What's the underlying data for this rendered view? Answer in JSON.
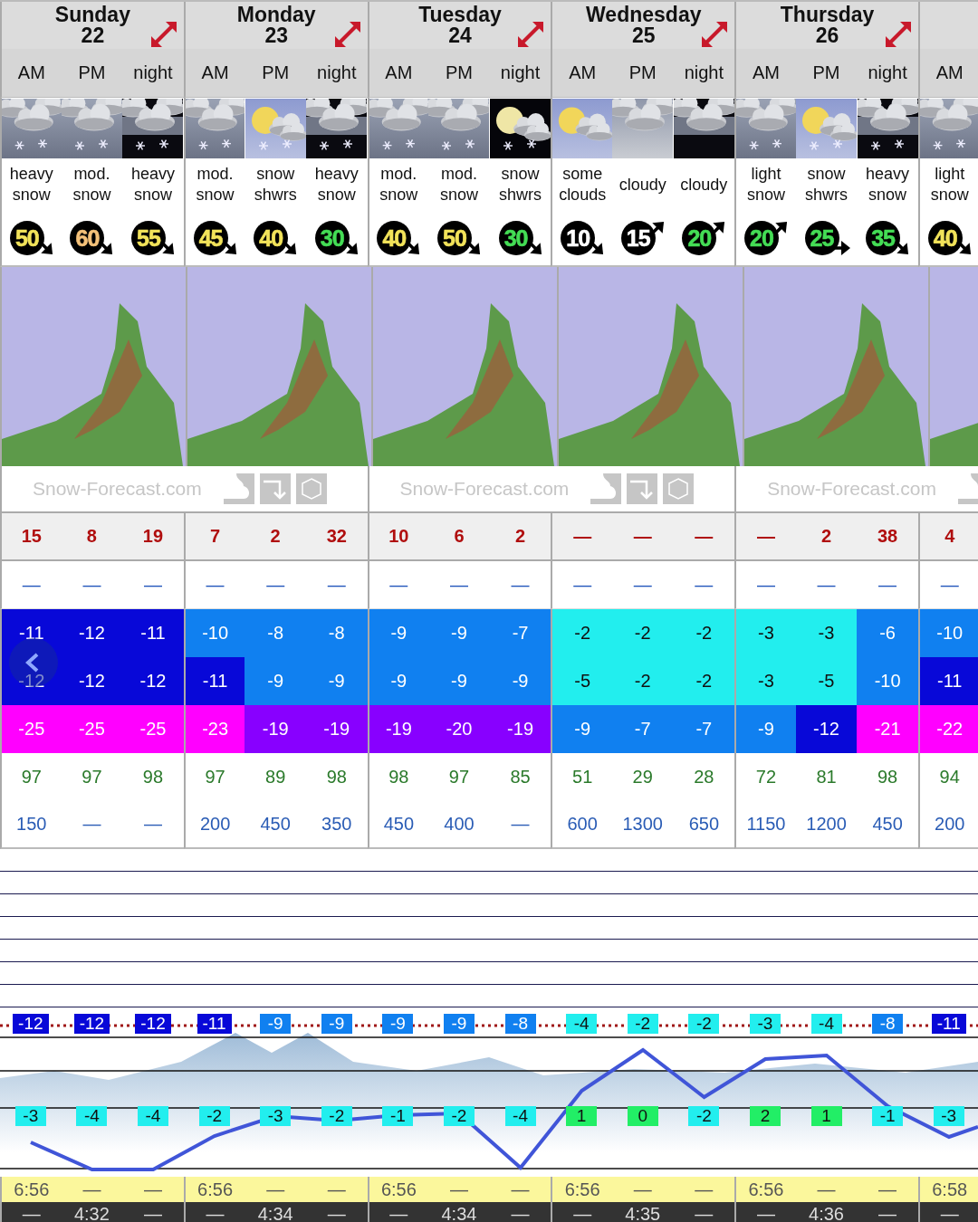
{
  "days": [
    {
      "name": "Sunday",
      "date": "22",
      "periods": [
        {
          "label": "AM",
          "kind": "overcast",
          "snowing": true,
          "summary": "heavy snow",
          "wind": {
            "speed": "50",
            "kind": "down",
            "color": "#f2e35a"
          },
          "snow": "15",
          "rain": "—",
          "max": {
            "value": "-11",
            "color": "#0808d8"
          },
          "min": {
            "value": "-12",
            "color": "#0808d8"
          },
          "chill": {
            "value": "-25",
            "color": "#ff00ff"
          },
          "humidity": "97",
          "freezing": "150",
          "upper": {
            "value": "-12",
            "color": "#0808d8"
          },
          "lower": {
            "value": "-3",
            "color": "#22eeee"
          },
          "sunrise": "6:56",
          "sunset": "—"
        },
        {
          "label": "PM",
          "kind": "overcast",
          "snowing": true,
          "summary": "mod. snow",
          "wind": {
            "speed": "60",
            "kind": "down",
            "color": "#f5c27a"
          },
          "snow": "8",
          "rain": "—",
          "max": {
            "value": "-12",
            "color": "#0808d8"
          },
          "min": {
            "value": "-12",
            "color": "#0808d8"
          },
          "chill": {
            "value": "-25",
            "color": "#ff00ff"
          },
          "humidity": "97",
          "freezing": "—",
          "upper": {
            "value": "-12",
            "color": "#0808d8"
          },
          "lower": {
            "value": "-4",
            "color": "#22eeee"
          },
          "sunrise": "—",
          "sunset": "4:32"
        },
        {
          "label": "night",
          "kind": "dark",
          "snowing": true,
          "summary": "heavy snow",
          "wind": {
            "speed": "55",
            "kind": "down",
            "color": "#f2e35a"
          },
          "snow": "19",
          "rain": "—",
          "max": {
            "value": "-11",
            "color": "#0808d8"
          },
          "min": {
            "value": "-12",
            "color": "#0808d8"
          },
          "chill": {
            "value": "-25",
            "color": "#ff00ff"
          },
          "humidity": "98",
          "freezing": "—",
          "upper": {
            "value": "-12",
            "color": "#0808d8"
          },
          "lower": {
            "value": "-4",
            "color": "#22eeee"
          },
          "sunrise": "—",
          "sunset": "—"
        }
      ]
    },
    {
      "name": "Monday",
      "date": "23",
      "periods": [
        {
          "label": "AM",
          "kind": "overcast",
          "snowing": true,
          "summary": "mod. snow",
          "wind": {
            "speed": "45",
            "kind": "down",
            "color": "#f2e35a"
          },
          "snow": "7",
          "rain": "—",
          "max": {
            "value": "-10",
            "color": "#1080f0"
          },
          "min": {
            "value": "-11",
            "color": "#0808d8"
          },
          "chill": {
            "value": "-23",
            "color": "#ff00ff"
          },
          "humidity": "97",
          "freezing": "200",
          "upper": {
            "value": "-11",
            "color": "#0808d8"
          },
          "lower": {
            "value": "-2",
            "color": "#22eeee"
          },
          "sunrise": "6:56",
          "sunset": "—"
        },
        {
          "label": "PM",
          "kind": "sunny",
          "snowing": true,
          "summary": "snow shwrs",
          "wind": {
            "speed": "40",
            "kind": "down",
            "color": "#f2e35a"
          },
          "snow": "2",
          "rain": "—",
          "max": {
            "value": "-8",
            "color": "#1080f0"
          },
          "min": {
            "value": "-9",
            "color": "#1080f0"
          },
          "chill": {
            "value": "-19",
            "color": "#8800ff"
          },
          "humidity": "89",
          "freezing": "450",
          "upper": {
            "value": "-9",
            "color": "#1080f0"
          },
          "lower": {
            "value": "-3",
            "color": "#22eeee"
          },
          "sunrise": "—",
          "sunset": "4:34"
        },
        {
          "label": "night",
          "kind": "dark",
          "snowing": true,
          "summary": "heavy snow",
          "wind": {
            "speed": "30",
            "kind": "down",
            "color": "#44dd55"
          },
          "snow": "32",
          "rain": "—",
          "max": {
            "value": "-8",
            "color": "#1080f0"
          },
          "min": {
            "value": "-9",
            "color": "#1080f0"
          },
          "chill": {
            "value": "-19",
            "color": "#8800ff"
          },
          "humidity": "98",
          "freezing": "350",
          "upper": {
            "value": "-9",
            "color": "#1080f0"
          },
          "lower": {
            "value": "-2",
            "color": "#22eeee"
          },
          "sunrise": "—",
          "sunset": "—"
        }
      ]
    },
    {
      "name": "Tuesday",
      "date": "24",
      "periods": [
        {
          "label": "AM",
          "kind": "overcast",
          "snowing": true,
          "summary": "mod. snow",
          "wind": {
            "speed": "40",
            "kind": "down",
            "color": "#f2e35a"
          },
          "snow": "10",
          "rain": "—",
          "max": {
            "value": "-9",
            "color": "#1080f0"
          },
          "min": {
            "value": "-9",
            "color": "#1080f0"
          },
          "chill": {
            "value": "-19",
            "color": "#8800ff"
          },
          "humidity": "98",
          "freezing": "450",
          "upper": {
            "value": "-9",
            "color": "#1080f0"
          },
          "lower": {
            "value": "-1",
            "color": "#22eeee"
          },
          "sunrise": "6:56",
          "sunset": "—"
        },
        {
          "label": "PM",
          "kind": "overcast",
          "snowing": true,
          "summary": "mod. snow",
          "wind": {
            "speed": "50",
            "kind": "down",
            "color": "#f2e35a"
          },
          "snow": "6",
          "rain": "—",
          "max": {
            "value": "-9",
            "color": "#1080f0"
          },
          "min": {
            "value": "-9",
            "color": "#1080f0"
          },
          "chill": {
            "value": "-20",
            "color": "#8800ff"
          },
          "humidity": "97",
          "freezing": "400",
          "upper": {
            "value": "-9",
            "color": "#1080f0"
          },
          "lower": {
            "value": "-2",
            "color": "#22eeee"
          },
          "sunrise": "—",
          "sunset": "4:34"
        },
        {
          "label": "night",
          "kind": "moon",
          "snowing": true,
          "summary": "snow shwrs",
          "wind": {
            "speed": "30",
            "kind": "down",
            "color": "#44dd55"
          },
          "snow": "2",
          "rain": "—",
          "max": {
            "value": "-7",
            "color": "#1080f0"
          },
          "min": {
            "value": "-9",
            "color": "#1080f0"
          },
          "chill": {
            "value": "-19",
            "color": "#8800ff"
          },
          "humidity": "85",
          "freezing": "—",
          "upper": {
            "value": "-8",
            "color": "#1080f0"
          },
          "lower": {
            "value": "-4",
            "color": "#22eeee"
          },
          "sunrise": "—",
          "sunset": "—"
        }
      ]
    },
    {
      "name": "Wednesday",
      "date": "25",
      "periods": [
        {
          "label": "AM",
          "kind": "sunny",
          "snowing": false,
          "summary": "some clouds",
          "wind": {
            "speed": "10",
            "kind": "down",
            "color": "#ffffff"
          },
          "snow": "—",
          "rain": "—",
          "max": {
            "value": "-2",
            "color": "#22eeee"
          },
          "min": {
            "value": "-5",
            "color": "#22eeee"
          },
          "chill": {
            "value": "-9",
            "color": "#1080f0"
          },
          "humidity": "51",
          "freezing": "600",
          "upper": {
            "value": "-4",
            "color": "#22eeee"
          },
          "lower": {
            "value": "1",
            "color": "#22ee66"
          },
          "sunrise": "6:56",
          "sunset": "—"
        },
        {
          "label": "PM",
          "kind": "cloudy",
          "snowing": false,
          "summary": "cloudy",
          "wind": {
            "speed": "15",
            "kind": "up",
            "color": "#ffffff"
          },
          "snow": "—",
          "rain": "—",
          "max": {
            "value": "-2",
            "color": "#22eeee"
          },
          "min": {
            "value": "-2",
            "color": "#22eeee"
          },
          "chill": {
            "value": "-7",
            "color": "#1080f0"
          },
          "humidity": "29",
          "freezing": "1300",
          "upper": {
            "value": "-2",
            "color": "#22eeee"
          },
          "lower": {
            "value": "0",
            "color": "#22ee66"
          },
          "sunrise": "—",
          "sunset": "4:35"
        },
        {
          "label": "night",
          "kind": "dark",
          "snowing": false,
          "summary": "cloudy",
          "wind": {
            "speed": "20",
            "kind": "up",
            "color": "#44dd55"
          },
          "snow": "—",
          "rain": "—",
          "max": {
            "value": "-2",
            "color": "#22eeee"
          },
          "min": {
            "value": "-2",
            "color": "#22eeee"
          },
          "chill": {
            "value": "-7",
            "color": "#1080f0"
          },
          "humidity": "28",
          "freezing": "650",
          "upper": {
            "value": "-2",
            "color": "#22eeee"
          },
          "lower": {
            "value": "-2",
            "color": "#22eeee"
          },
          "sunrise": "—",
          "sunset": "—"
        }
      ]
    },
    {
      "name": "Thursday",
      "date": "26",
      "periods": [
        {
          "label": "AM",
          "kind": "overcast",
          "snowing": true,
          "summary": "light snow",
          "wind": {
            "speed": "20",
            "kind": "up",
            "color": "#44dd55"
          },
          "snow": "—",
          "rain": "—",
          "max": {
            "value": "-3",
            "color": "#22eeee"
          },
          "min": {
            "value": "-3",
            "color": "#22eeee"
          },
          "chill": {
            "value": "-9",
            "color": "#1080f0"
          },
          "humidity": "72",
          "freezing": "1150",
          "upper": {
            "value": "-3",
            "color": "#22eeee"
          },
          "lower": {
            "value": "2",
            "color": "#22ee66"
          },
          "sunrise": "6:56",
          "sunset": "—"
        },
        {
          "label": "PM",
          "kind": "sunny",
          "snowing": true,
          "summary": "snow shwrs",
          "wind": {
            "speed": "25",
            "kind": "level",
            "color": "#44dd55"
          },
          "snow": "2",
          "rain": "—",
          "max": {
            "value": "-3",
            "color": "#22eeee"
          },
          "min": {
            "value": "-5",
            "color": "#22eeee"
          },
          "chill": {
            "value": "-12",
            "color": "#0808d8"
          },
          "humidity": "81",
          "freezing": "1200",
          "upper": {
            "value": "-4",
            "color": "#22eeee"
          },
          "lower": {
            "value": "1",
            "color": "#22ee66"
          },
          "sunrise": "—",
          "sunset": "4:36"
        },
        {
          "label": "night",
          "kind": "dark",
          "snowing": true,
          "summary": "heavy snow",
          "wind": {
            "speed": "35",
            "kind": "down",
            "color": "#44dd55"
          },
          "snow": "38",
          "rain": "—",
          "max": {
            "value": "-6",
            "color": "#1080f0"
          },
          "min": {
            "value": "-10",
            "color": "#1080f0"
          },
          "chill": {
            "value": "-21",
            "color": "#ff00ff"
          },
          "humidity": "98",
          "freezing": "450",
          "upper": {
            "value": "-8",
            "color": "#1080f0"
          },
          "lower": {
            "value": "-1",
            "color": "#22eeee"
          },
          "sunrise": "—",
          "sunset": "—"
        }
      ]
    },
    {
      "periods": [
        {
          "label": "AM",
          "kind": "overcast",
          "snowing": true,
          "summary": "light snow",
          "wind": {
            "speed": "40",
            "kind": "down",
            "color": "#f2e35a"
          },
          "snow": "4",
          "rain": "—",
          "max": {
            "value": "-10",
            "color": "#1080f0"
          },
          "min": {
            "value": "-11",
            "color": "#0808d8"
          },
          "chill": {
            "value": "-22",
            "color": "#ff00ff"
          },
          "humidity": "94",
          "freezing": "200",
          "upper": {
            "value": "-11",
            "color": "#0808d8"
          },
          "lower": {
            "value": "-3",
            "color": "#22eeee"
          },
          "sunrise": "6:58",
          "sunset": "—"
        }
      ]
    }
  ],
  "map_footers": [
    {
      "text": "Snow-Forecast.com"
    },
    {
      "text": "Snow-Forecast.com"
    },
    {
      "text": "Snow-Forecast.com"
    }
  ]
}
